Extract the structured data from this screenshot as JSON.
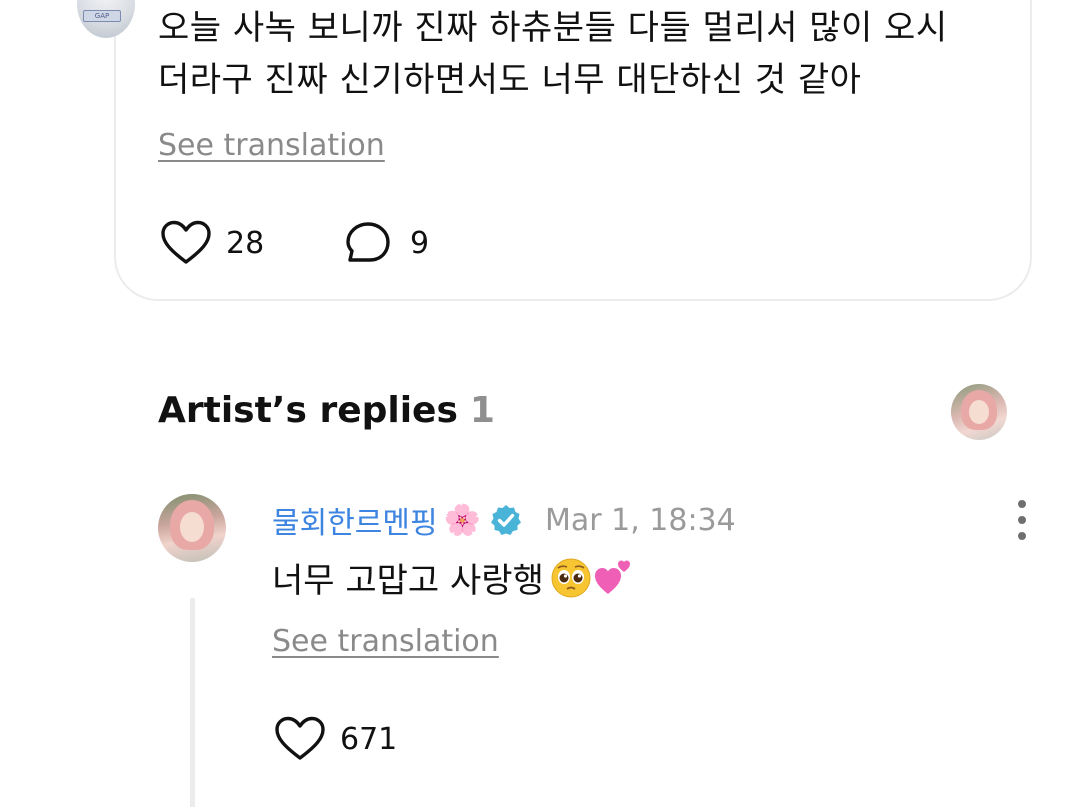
{
  "post": {
    "text_line1": "오늘 사녹 보니까 진짜 하츄분들 다들 멀리서 많이 오시",
    "text_line2": "더라구 진짜 신기하면서도 너무 대단하신 것 같아",
    "see_translation": "See translation",
    "likes": "28",
    "comments": "9",
    "avatar_patch_text": "GAP"
  },
  "artist_replies": {
    "title": "Artist’s replies",
    "count": "1"
  },
  "reply": {
    "author": "물회한르멘핑",
    "author_emoji": "🌸",
    "timestamp": "Mar 1, 18:34",
    "text": "너무 고맙고 사랑행",
    "see_translation": "See translation",
    "likes": "671"
  },
  "icons": {
    "like": "heart-icon",
    "comment": "comment-bubble-icon",
    "verified": "verified-badge-icon",
    "more": "more-vertical-icon"
  },
  "colors": {
    "author_name": "#3d85e0",
    "verified_badge": "#4ab3d8",
    "muted_text": "#8a8a8a",
    "card_border": "#ececec"
  }
}
